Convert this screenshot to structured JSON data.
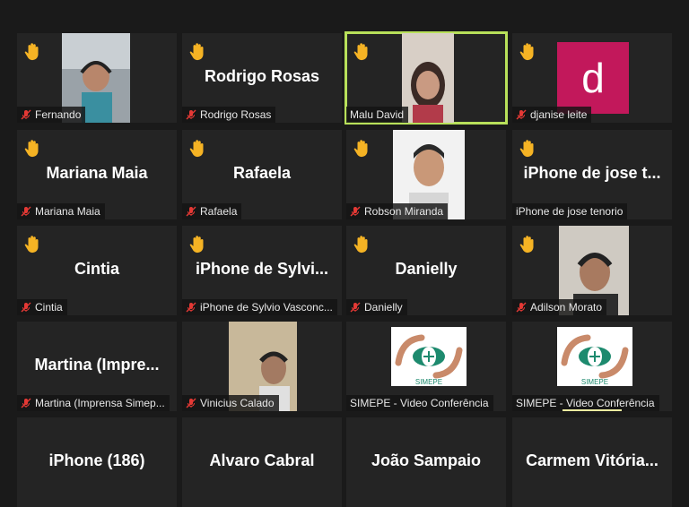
{
  "participants": [
    {
      "name": "Fernando",
      "label": "Fernando",
      "muted": true,
      "hand": true,
      "type": "video"
    },
    {
      "name": "Rodrigo Rosas",
      "label": "Rodrigo Rosas",
      "muted": true,
      "hand": true,
      "type": "name"
    },
    {
      "name": "Malu David",
      "label": "Malu David",
      "muted": false,
      "hand": true,
      "type": "video",
      "speaking": true
    },
    {
      "name": "djanise leite",
      "label": "djanise leite",
      "muted": true,
      "hand": true,
      "type": "avatar",
      "avatar_letter": "d",
      "avatar_color": "#c2185b"
    },
    {
      "name": "Mariana Maia",
      "label": "Mariana Maia",
      "muted": true,
      "hand": true,
      "type": "name"
    },
    {
      "name": "Rafaela",
      "label": "Rafaela",
      "muted": true,
      "hand": true,
      "type": "name"
    },
    {
      "name": "Robson Miranda",
      "label": "Robson Miranda",
      "muted": true,
      "hand": true,
      "type": "video"
    },
    {
      "name": "iPhone de jose t...",
      "label": "iPhone de jose tenorio",
      "muted": false,
      "hand": true,
      "type": "name"
    },
    {
      "name": "Cintia",
      "label": "Cintia",
      "muted": true,
      "hand": true,
      "type": "name"
    },
    {
      "name": "iPhone de Sylvi...",
      "label": "iPhone de Sylvio Vasconc...",
      "muted": true,
      "hand": true,
      "type": "name"
    },
    {
      "name": "Danielly",
      "label": "Danielly",
      "muted": true,
      "hand": true,
      "type": "name"
    },
    {
      "name": "Adilson Morato",
      "label": "Adilson Morato",
      "muted": true,
      "hand": true,
      "type": "video"
    },
    {
      "name": "Martina  (Impre...",
      "label": "Martina (Imprensa Simep...",
      "muted": true,
      "hand": false,
      "type": "name"
    },
    {
      "name": "Vinicius Calado",
      "label": "Vinicius Calado",
      "muted": true,
      "hand": false,
      "type": "video"
    },
    {
      "name": "SIMEPE - Video Conferência",
      "label": "SIMEPE - Video Conferência",
      "muted": false,
      "hand": false,
      "type": "logo"
    },
    {
      "name": "SIMEPE - Video Conferência",
      "label": "SIMEPE - Video Conferência",
      "muted": false,
      "hand": false,
      "type": "logo"
    },
    {
      "name": "iPhone (186)",
      "label": "",
      "muted": false,
      "hand": false,
      "type": "name"
    },
    {
      "name": "Alvaro Cabral",
      "label": "",
      "muted": false,
      "hand": false,
      "type": "name"
    },
    {
      "name": "João Sampaio",
      "label": "",
      "muted": false,
      "hand": false,
      "type": "name"
    },
    {
      "name": "Carmem  Vitória...",
      "label": "",
      "muted": false,
      "hand": false,
      "type": "name"
    }
  ],
  "colors": {
    "tile_bg": "#242424",
    "speaking_border": "#b8e05a",
    "muted_mic": "#e53935",
    "hand": "#f5b324"
  },
  "logo_text": "SIMEPE"
}
